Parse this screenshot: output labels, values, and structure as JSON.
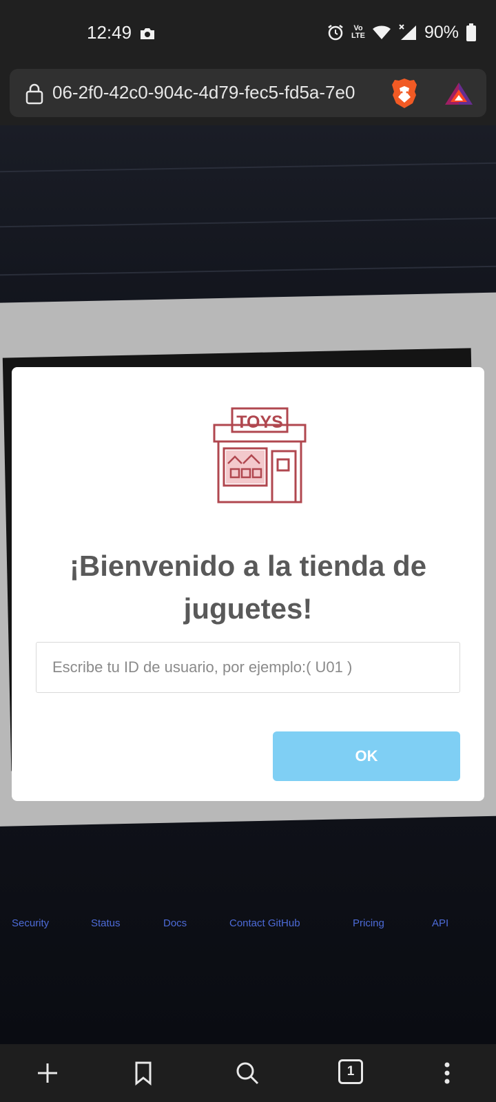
{
  "status_bar": {
    "time": "12:49",
    "network_label_top": "Vo",
    "network_label_bottom": "LTE",
    "battery_percent": "90%"
  },
  "browser": {
    "url": "06-2f0-42c0-904c-4d79-fec5-fd5a-7e0",
    "tab_count": "1"
  },
  "background_footer_links": [
    "Security",
    "Status",
    "Docs",
    "Contact GitHub",
    "Pricing",
    "API"
  ],
  "modal": {
    "logo_text": "TOYS",
    "title": "¡Bienvenido a la tienda de juguetes!",
    "input_placeholder": "Escribe tu ID de usuario, por ejemplo:( U01 )",
    "input_value": "",
    "ok_label": "OK"
  },
  "colors": {
    "logo": "#b0474f",
    "ok_button": "#7fcff4",
    "title_text": "#595959"
  }
}
